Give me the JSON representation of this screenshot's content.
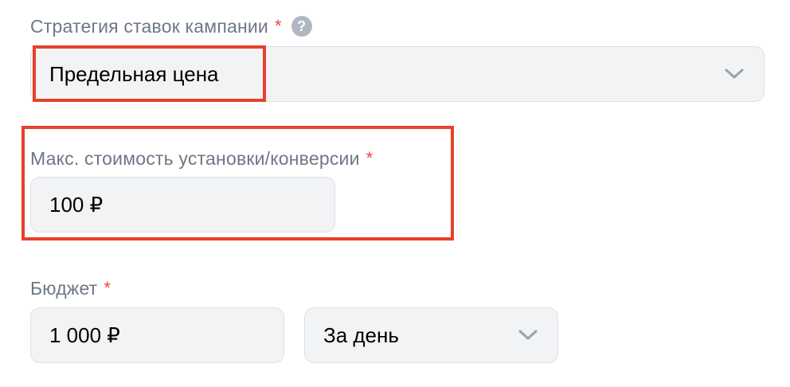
{
  "strategy": {
    "label": "Стратегия ставок кампании",
    "required_mark": "*",
    "help_glyph": "?",
    "value": "Предельная цена",
    "icon": "chevron-down-icon"
  },
  "max_cost": {
    "label": "Макс. стоимость установки/конверсии",
    "required_mark": "*",
    "value": "100 ₽"
  },
  "budget": {
    "label": "Бюджет",
    "required_mark": "*",
    "amount": "1 000 ₽",
    "period": "За день",
    "period_icon": "chevron-down-icon"
  },
  "colors": {
    "highlight": "#e8412b",
    "required": "#e64646",
    "field_bg": "#f2f3f5",
    "label": "#6d7785"
  }
}
